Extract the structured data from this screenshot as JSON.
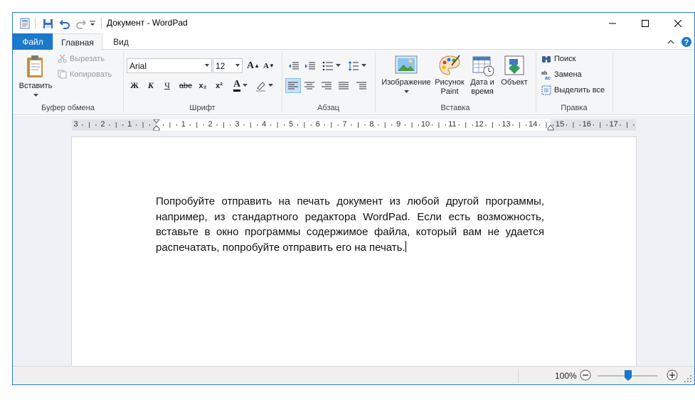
{
  "window": {
    "title": "Документ - WordPad",
    "accent": "#1979ca"
  },
  "tabs": {
    "file": "Файл",
    "home": "Главная",
    "view": "Вид"
  },
  "ribbon": {
    "clipboard": {
      "paste_label": "Вставить",
      "cut_label": "Вырезать",
      "copy_label": "Копировать",
      "group_label": "Буфер обмена"
    },
    "font": {
      "font_name": "Arial",
      "font_size": "12",
      "group_label": "Шрифт",
      "bold": "Ж",
      "italic": "К",
      "underline": "Ч",
      "strikethrough": "abe",
      "subscript": "x₂",
      "superscript": "x²",
      "font_color_glyph": "A",
      "grow_glyph": "A",
      "shrink_glyph": "A"
    },
    "paragraph": {
      "group_label": "Абзац"
    },
    "insert": {
      "picture_label": "Изображение",
      "paint_label": "Рисунок Paint",
      "datetime_label": "Дата и время",
      "object_label": "Объект",
      "group_label": "Вставка"
    },
    "editing": {
      "find_label": "Поиск",
      "replace_label": "Замена",
      "select_all_label": "Выделить все",
      "group_label": "Правка"
    }
  },
  "ruler": {
    "numbers": [
      "3",
      "2",
      "1",
      "1",
      "2",
      "3",
      "4",
      "5",
      "6",
      "7",
      "8",
      "9",
      "10",
      "11",
      "12",
      "13",
      "14",
      "15",
      "16",
      "17"
    ]
  },
  "document": {
    "text": "Попробуйте отправить на печать документ из любой другой программы, например, из стандартного редактора WordPad. Если есть возможность, вставьте в окно программы содержимое файла, который вам не удается распечатать, попробуйте отправить его на печать."
  },
  "status": {
    "zoom": "100%",
    "zoom_level_percent": 100
  }
}
